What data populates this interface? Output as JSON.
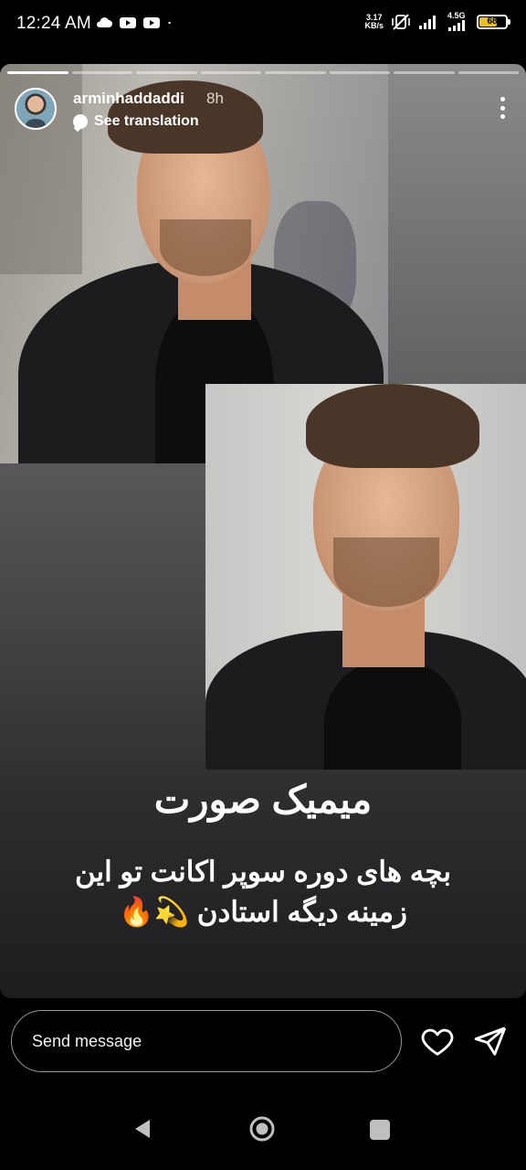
{
  "status_bar": {
    "time": "12:24 AM",
    "net_speed_value": "3.17",
    "net_speed_unit": "KB/s",
    "network_type": "4.5G",
    "battery_level": "68",
    "battery_fraction": 0.68,
    "battery_color": "#e8c020",
    "left_icons": [
      "cloud-icon",
      "youtube-icon",
      "youtube-icon",
      "dot-icon"
    ],
    "right_icons": [
      "mute-vibrate-icon",
      "signal-icon",
      "signal-icon",
      "battery-icon"
    ]
  },
  "story": {
    "progress_segments": 8,
    "progress_completed": 1,
    "username": "arminhaddaddi",
    "age": "8h",
    "translation_label": "See translation",
    "title": "میمیک صورت",
    "caption_lines": [
      "بچه های دوره سوپر اکانت تو این",
      "زمینه دیگه استادن 💫🔥"
    ]
  },
  "reply": {
    "placeholder": "Send message",
    "like_icon": "heart-icon",
    "send_icon": "send-icon"
  },
  "nav": {
    "icons": [
      "back-icon",
      "home-icon",
      "recents-icon"
    ]
  }
}
